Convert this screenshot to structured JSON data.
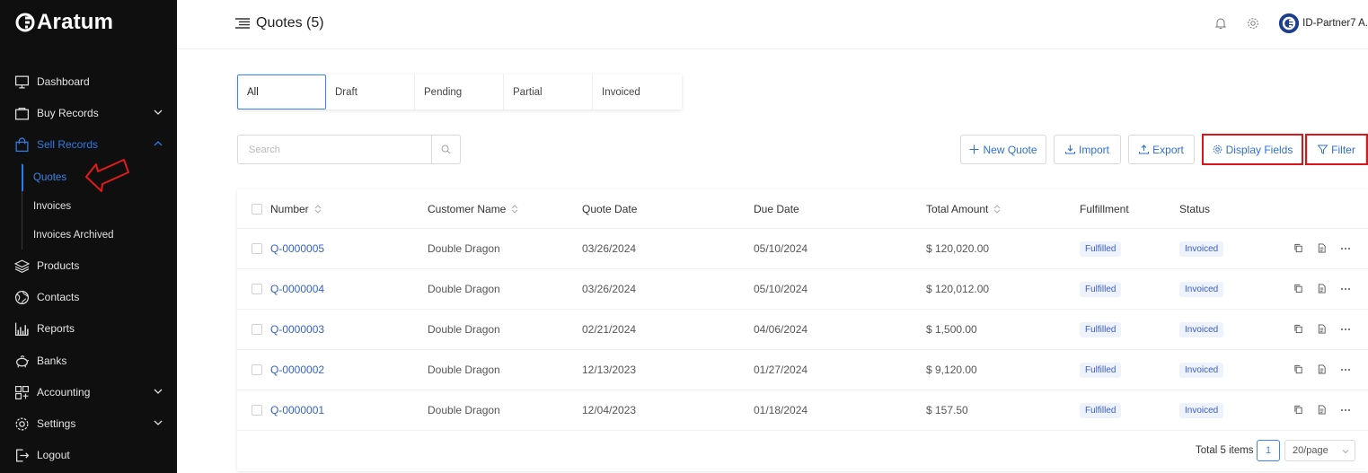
{
  "app": {
    "logo_text": "Aratum"
  },
  "sidebar": {
    "items": [
      {
        "label": "Dashboard",
        "icon": "monitor-icon"
      },
      {
        "label": "Buy Records",
        "icon": "bag-icon"
      },
      {
        "label": "Sell Records",
        "icon": "shopping-bag-icon"
      },
      {
        "label": "Products",
        "icon": "layers-icon"
      },
      {
        "label": "Contacts",
        "icon": "globe-icon"
      },
      {
        "label": "Reports",
        "icon": "chart-icon"
      },
      {
        "label": "Banks",
        "icon": "piggy-bank-icon"
      },
      {
        "label": "Accounting",
        "icon": "grid-icon"
      },
      {
        "label": "Settings",
        "icon": "gear-icon"
      },
      {
        "label": "Logout",
        "icon": "logout-icon"
      }
    ],
    "sub_items": [
      {
        "label": "Quotes"
      },
      {
        "label": "Invoices"
      },
      {
        "label": "Invoices Archived"
      }
    ],
    "accent": "#2f7be5"
  },
  "header": {
    "title": "Quotes (5)",
    "user_name": "ID-Partner7 A."
  },
  "tabs": [
    {
      "label": "All"
    },
    {
      "label": "Draft"
    },
    {
      "label": "Pending"
    },
    {
      "label": "Partial"
    },
    {
      "label": "Invoiced"
    }
  ],
  "toolbar": {
    "search_placeholder": "Search",
    "new_quote": "New Quote",
    "import": "Import",
    "export": "Export",
    "display_fields": "Display Fields",
    "filter": "Filter"
  },
  "table": {
    "columns": [
      "Number",
      "Customer Name",
      "Quote Date",
      "Due Date",
      "Total Amount",
      "Fulfillment",
      "Status"
    ],
    "rows": [
      [
        "Q-0000005",
        "Double Dragon",
        "03/26/2024",
        "05/10/2024",
        "$ 120,020.00",
        "Fulfilled",
        "Invoiced"
      ],
      [
        "Q-0000004",
        "Double Dragon",
        "03/26/2024",
        "05/10/2024",
        "$ 120,012.00",
        "Fulfilled",
        "Invoiced"
      ],
      [
        "Q-0000003",
        "Double Dragon",
        "02/21/2024",
        "04/06/2024",
        "$ 1,500.00",
        "Fulfilled",
        "Invoiced"
      ],
      [
        "Q-0000002",
        "Double Dragon",
        "12/13/2023",
        "01/27/2024",
        "$ 9,120.00",
        "Fulfilled",
        "Invoiced"
      ],
      [
        "Q-0000001",
        "Double Dragon",
        "12/04/2023",
        "01/18/2024",
        "$ 157.50",
        "Fulfilled",
        "Invoiced"
      ]
    ]
  },
  "pagination": {
    "total": "Total 5 items",
    "current_page": "1",
    "per_page": "20/page"
  },
  "colors": {
    "link": "#3763c4",
    "highlight": "#d9161a"
  }
}
